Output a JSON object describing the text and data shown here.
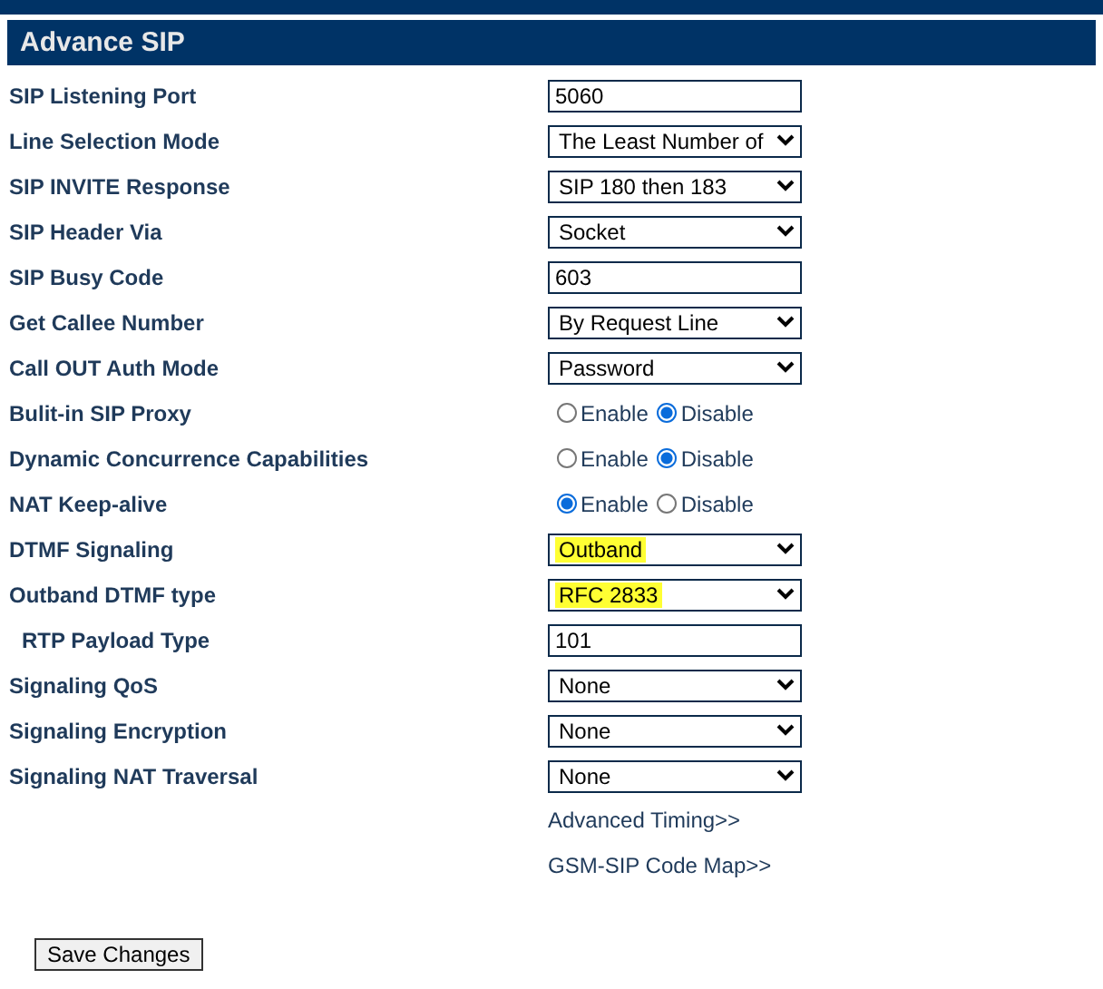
{
  "header": {
    "title": "Advance SIP"
  },
  "rows": [
    {
      "kind": "text",
      "label": "SIP Listening Port",
      "indented": false,
      "value": "5060"
    },
    {
      "kind": "select",
      "label": "Line Selection Mode",
      "indented": false,
      "value": "The Least Number of",
      "highlighted": false
    },
    {
      "kind": "select",
      "label": "SIP INVITE Response",
      "indented": false,
      "value": "SIP 180 then 183",
      "highlighted": false
    },
    {
      "kind": "select",
      "label": "SIP Header Via",
      "indented": false,
      "value": "Socket",
      "highlighted": false
    },
    {
      "kind": "text",
      "label": "SIP Busy Code",
      "indented": false,
      "value": "603"
    },
    {
      "kind": "select",
      "label": "Get Callee Number",
      "indented": false,
      "value": "By Request Line",
      "highlighted": false
    },
    {
      "kind": "select",
      "label": "Call OUT Auth Mode",
      "indented": false,
      "value": "Password",
      "highlighted": false
    },
    {
      "kind": "radio",
      "label": "Bulit-in SIP Proxy",
      "indented": false,
      "options": [
        {
          "label": "Enable",
          "selected": false
        },
        {
          "label": "Disable",
          "selected": true
        }
      ]
    },
    {
      "kind": "radio",
      "label": "Dynamic Concurrence Capabilities",
      "indented": false,
      "options": [
        {
          "label": "Enable",
          "selected": false
        },
        {
          "label": "Disable",
          "selected": true
        }
      ]
    },
    {
      "kind": "radio",
      "label": "NAT Keep-alive",
      "indented": false,
      "options": [
        {
          "label": "Enable",
          "selected": true
        },
        {
          "label": "Disable",
          "selected": false
        }
      ]
    },
    {
      "kind": "select",
      "label": "DTMF Signaling",
      "indented": false,
      "value": "Outband",
      "highlighted": true
    },
    {
      "kind": "select",
      "label": "Outband DTMF type",
      "indented": false,
      "value": "RFC 2833",
      "highlighted": true
    },
    {
      "kind": "text",
      "label": "RTP Payload Type",
      "indented": true,
      "value": "101"
    },
    {
      "kind": "select",
      "label": "Signaling QoS",
      "indented": false,
      "value": "None",
      "highlighted": false
    },
    {
      "kind": "select",
      "label": "Signaling Encryption",
      "indented": false,
      "value": "None",
      "highlighted": false
    },
    {
      "kind": "select",
      "label": "Signaling NAT Traversal",
      "indented": false,
      "value": "None",
      "highlighted": false
    }
  ],
  "links": [
    "Advanced Timing>>",
    "GSM-SIP Code Map>>"
  ],
  "save_button": "Save Changes"
}
